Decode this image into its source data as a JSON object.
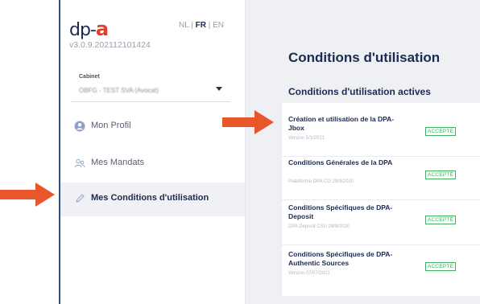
{
  "brand": {
    "logo_prefix": "dp-",
    "logo_letter": "a",
    "version": "v3.0.9.202112101424"
  },
  "languages": {
    "nl": "NL",
    "sep1": "|",
    "fr": "FR",
    "sep2": "|",
    "en": "EN",
    "active": "FR"
  },
  "cabinet": {
    "label": "Cabinet",
    "value": "OBFG - TEST SVA (Avocat)"
  },
  "nav": [
    {
      "label": "Mon Profil",
      "icon": "user-icon",
      "active": false
    },
    {
      "label": "Mes Mandats",
      "icon": "users-icon",
      "active": false
    },
    {
      "label": "Mes Conditions d'utilisation",
      "icon": "pen-icon",
      "active": true
    }
  ],
  "main": {
    "title": "Conditions d'utilisation",
    "section_title": "Conditions d'utilisation actives"
  },
  "terms": [
    {
      "title": "Création et utilisation de la DPA-Jbox",
      "subtitle": "Version 5/1/2021",
      "status": "ACCEPTÉ"
    },
    {
      "title": "Conditions Générales de la DPA",
      "subtitle": "Plateforme DPA CG 29/9/2020",
      "status": "ACCEPTÉ"
    },
    {
      "title": "Conditions Spécifiques de DPA-Deposit",
      "subtitle": "DPA Deposit CSU 29/9/2020",
      "status": "ACCEPTÉ"
    },
    {
      "title": "Conditions Spécifiques de DPA-Authentic Sources",
      "subtitle": "Version 07/07/2021",
      "status": "ACCEPTÉ"
    }
  ],
  "colors": {
    "accent": "#e63c2e",
    "brand_navy": "#1c2a52",
    "accepted": "#3fae5e",
    "frame": "#2f4f8c"
  }
}
